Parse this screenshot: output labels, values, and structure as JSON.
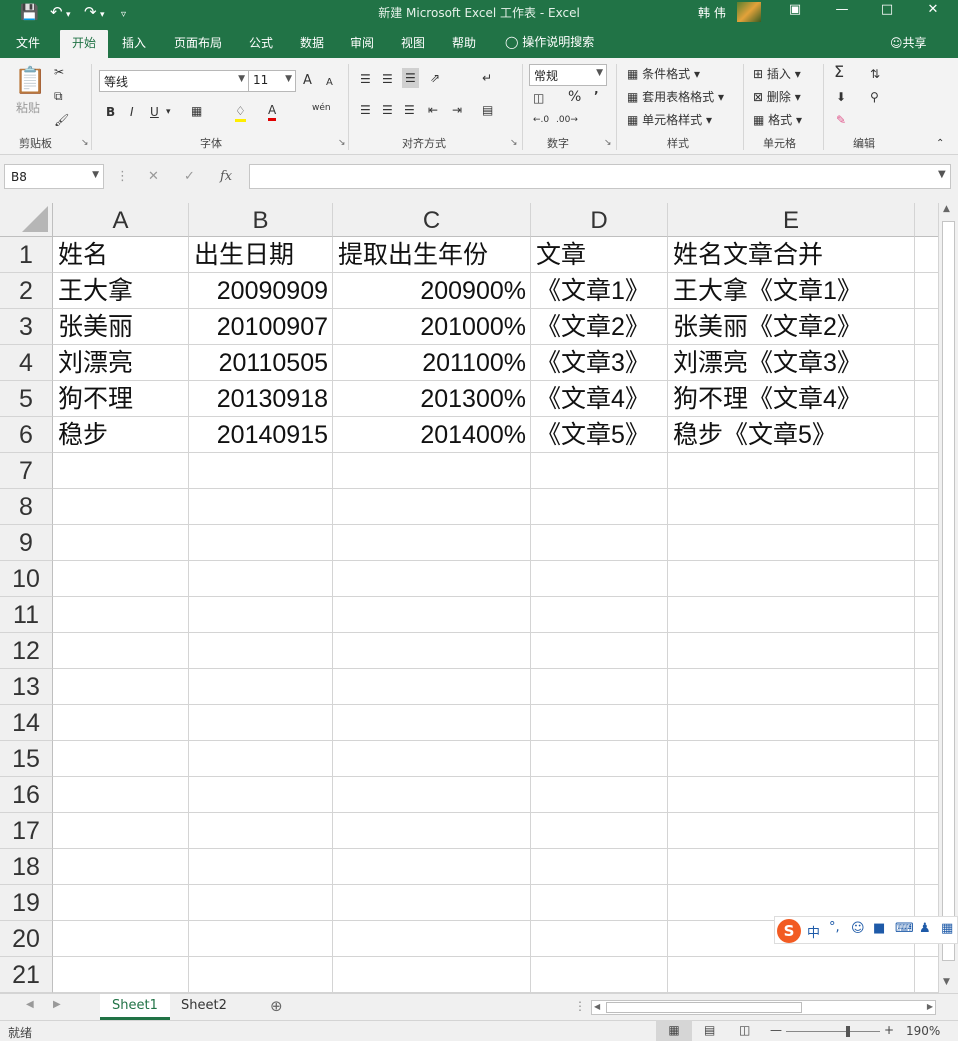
{
  "window": {
    "title": "新建 Microsoft Excel 工作表  -  Excel",
    "user_name": "韩 伟"
  },
  "ribbon_tabs": [
    {
      "label": "文件",
      "active": false
    },
    {
      "label": "开始",
      "active": true
    },
    {
      "label": "插入",
      "active": false
    },
    {
      "label": "页面布局",
      "active": false
    },
    {
      "label": "公式",
      "active": false
    },
    {
      "label": "数据",
      "active": false
    },
    {
      "label": "审阅",
      "active": false
    },
    {
      "label": "视图",
      "active": false
    },
    {
      "label": "帮助",
      "active": false
    }
  ],
  "tell_me": "操作说明搜索",
  "share": "共享",
  "ribbon": {
    "clipboard": {
      "label": "剪贴板",
      "paste": "粘贴"
    },
    "font": {
      "label": "字体",
      "name": "等线",
      "size": "11",
      "bold": "B",
      "italic": "I",
      "underline": "U",
      "grow": "A",
      "shrink": "A",
      "font_color": "A",
      "phonetic": "wén"
    },
    "alignment": {
      "label": "对齐方式"
    },
    "number": {
      "label": "数字",
      "format": "常规",
      "percent": "%",
      "comma": "’"
    },
    "styles": {
      "label": "样式",
      "conditional": "条件格式",
      "table": "套用表格格式",
      "cell_styles": "单元格样式"
    },
    "cells": {
      "label": "单元格",
      "insert": "插入",
      "delete": "删除",
      "format": "格式"
    },
    "editing": {
      "label": "编辑"
    }
  },
  "formula_bar": {
    "name_box": "B8",
    "fx": "fx",
    "formula": ""
  },
  "columns": [
    "A",
    "B",
    "C",
    "D",
    "E"
  ],
  "row_numbers": [
    "1",
    "2",
    "3",
    "4",
    "5",
    "6",
    "7",
    "8",
    "9",
    "10",
    "11",
    "12",
    "13",
    "14",
    "15",
    "16",
    "17",
    "18",
    "19",
    "20",
    "21"
  ],
  "rows": [
    [
      "姓名",
      "出生日期",
      "提取出生年份",
      "文章",
      "姓名文章合并"
    ],
    [
      "王大拿",
      "20090909",
      "200900%",
      "《文章1》",
      "王大拿《文章1》"
    ],
    [
      "张美丽",
      "20100907",
      "201000%",
      "《文章2》",
      "张美丽《文章2》"
    ],
    [
      "刘漂亮",
      "20110505",
      "201100%",
      "《文章3》",
      "刘漂亮《文章3》"
    ],
    [
      "狗不理",
      "20130918",
      "201300%",
      "《文章4》",
      "狗不理《文章4》"
    ],
    [
      "稳步",
      "20140915",
      "201400%",
      "《文章5》",
      "稳步《文章5》"
    ]
  ],
  "ime": {
    "lang": "中",
    "punct": "°,"
  },
  "sheets": [
    {
      "name": "Sheet1",
      "active": true
    },
    {
      "name": "Sheet2",
      "active": false
    }
  ],
  "status": {
    "ready": "就绪",
    "zoom": "190%"
  }
}
